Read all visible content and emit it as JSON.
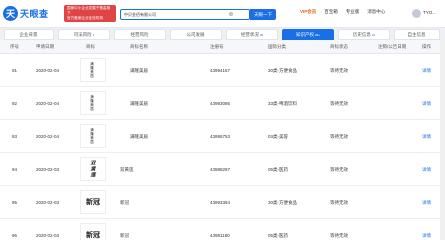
{
  "header": {
    "logo_mark": "天",
    "logo_text": "天眼查",
    "banner_line1": "国家中小企业发展子基金旗下",
    "banner_line2": "官方备案企业征信机构",
    "search_value": "中贝金佰有限公司",
    "search_button": "天眼一下",
    "nav": [
      "VIP会员",
      "百宝箱",
      "专业版",
      "消息中心"
    ],
    "user": "TYO..."
  },
  "tabs": [
    {
      "label": "企业背景",
      "badge": ""
    },
    {
      "label": "司法风险",
      "badge": "1"
    },
    {
      "label": "经营风险",
      "badge": ""
    },
    {
      "label": "公司发展",
      "badge": ""
    },
    {
      "label": "经营状况",
      "badge": "20"
    },
    {
      "label": "知识产权",
      "badge": "99+"
    },
    {
      "label": "历史信息",
      "badge": "10"
    },
    {
      "label": "自主信息",
      "badge": ""
    }
  ],
  "table": {
    "columns": [
      "序号",
      "申请日期",
      "商标",
      "商标名称",
      "注册号",
      "国际分类",
      "商标状态",
      "注销/公告日期",
      "操作"
    ],
    "rows": [
      {
        "index": "91",
        "date": "2020-02-04",
        "thumb": "满隆美居",
        "thumb_style": "vertical",
        "name": "满隆美居",
        "reg": "43994167",
        "class": "30类-方便食品",
        "status": "等待无效",
        "detail": "详情"
      },
      {
        "index": "92",
        "date": "2020-02-04",
        "thumb": "满隆美居",
        "thumb_style": "vertical",
        "name": "满隆美居",
        "reg": "43993086",
        "class": "33类-啤酒饮料",
        "status": "等待无效",
        "detail": "详情"
      },
      {
        "index": "93",
        "date": "2020-02-04",
        "thumb": "满隆美居",
        "thumb_style": "vertical",
        "name": "满隆美居",
        "reg": "43995753",
        "class": "03类-美容",
        "status": "等待无效",
        "detail": "详情"
      },
      {
        "index": "94",
        "date": "2020-02-03",
        "thumb": "双黄莲",
        "thumb_style": "callig",
        "name": "双黄莲",
        "reg": "43988287",
        "class": "05类-医药",
        "status": "等待无效",
        "detail": "详情"
      },
      {
        "index": "95",
        "date": "2020-02-03",
        "thumb": "新冠",
        "thumb_style": "bigtext",
        "name": "新冠",
        "reg": "43993364",
        "class": "30类-方便食品",
        "status": "等待无效",
        "detail": "详情"
      },
      {
        "index": "96",
        "date": "2020-02-03",
        "thumb": "新冠",
        "thumb_style": "bigtext",
        "name": "新冠",
        "reg": "43981180",
        "class": "05类-医药",
        "status": "等待无效",
        "detail": "详情"
      }
    ]
  }
}
